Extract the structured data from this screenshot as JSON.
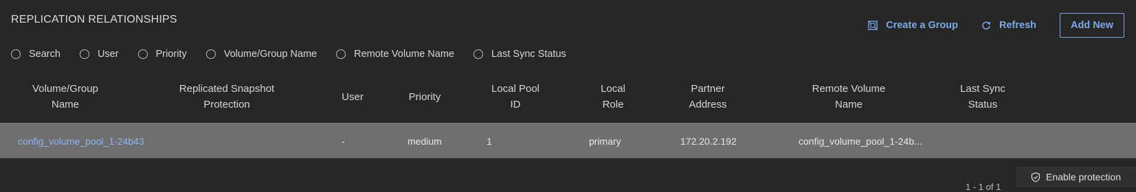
{
  "header": {
    "title": "REPLICATION RELATIONSHIPS",
    "create_group_label": "Create a Group",
    "refresh_label": "Refresh",
    "add_new_label": "Add New"
  },
  "filters": [
    "Search",
    "User",
    "Priority",
    "Volume/Group Name",
    "Remote Volume Name",
    "Last Sync Status"
  ],
  "table": {
    "columns": [
      [
        "Volume/Group",
        "Name"
      ],
      [
        "Replicated Snapshot",
        "Protection"
      ],
      [
        "User",
        ""
      ],
      [
        "Priority",
        ""
      ],
      [
        "Local Pool",
        "ID"
      ],
      [
        "Local",
        "Role"
      ],
      [
        "Partner",
        "Address"
      ],
      [
        "Remote Volume",
        "Name"
      ],
      [
        "Last Sync",
        "Status"
      ]
    ],
    "rows": [
      {
        "volume_group_name": "config_volume_pool_1-24b43",
        "replicated_snapshot_protection": "",
        "user": "-",
        "priority": "medium",
        "local_pool_id": "1",
        "local_role": "primary",
        "partner_address": "172.20.2.192",
        "remote_volume_name": "config_volume_pool_1-24b...",
        "last_sync_status": ""
      }
    ]
  },
  "footer": {
    "enable_protection_label": "Enable protection",
    "pagination_partial": "1 - 1 of 1"
  },
  "colors": {
    "background": "#262626",
    "accent": "#7fa8e8",
    "row_selected": "#6f6f6f"
  }
}
